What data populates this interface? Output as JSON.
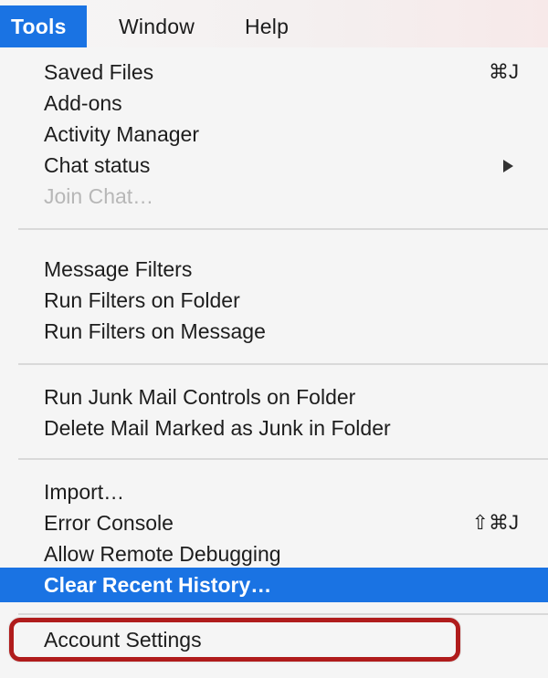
{
  "menubar": {
    "items": [
      "Tools",
      "Window",
      "Help"
    ],
    "active": "Tools"
  },
  "menu": {
    "groups": [
      [
        {
          "label": "Saved Files",
          "shortcut": "⌘J"
        },
        {
          "label": "Add-ons"
        },
        {
          "label": "Activity Manager"
        },
        {
          "label": "Chat status",
          "submenu": true
        },
        {
          "label": "Join Chat…",
          "disabled": true
        }
      ],
      [
        {
          "label": "Message Filters"
        },
        {
          "label": "Run Filters on Folder"
        },
        {
          "label": "Run Filters on Message"
        }
      ],
      [
        {
          "label": "Run Junk Mail Controls on Folder"
        },
        {
          "label": "Delete Mail Marked as Junk in Folder"
        }
      ],
      [
        {
          "label": "Import…"
        },
        {
          "label": "Error Console",
          "shortcut": "⇧⌘J"
        },
        {
          "label": "Allow Remote Debugging"
        },
        {
          "label": "Clear Recent History…",
          "highlighted": true
        }
      ],
      [
        {
          "label": "Account Settings",
          "callout": true
        }
      ]
    ]
  },
  "colors": {
    "highlight": "#1a73e3",
    "callout_border": "#b01c1c",
    "disabled_text": "#b7b7b7"
  }
}
